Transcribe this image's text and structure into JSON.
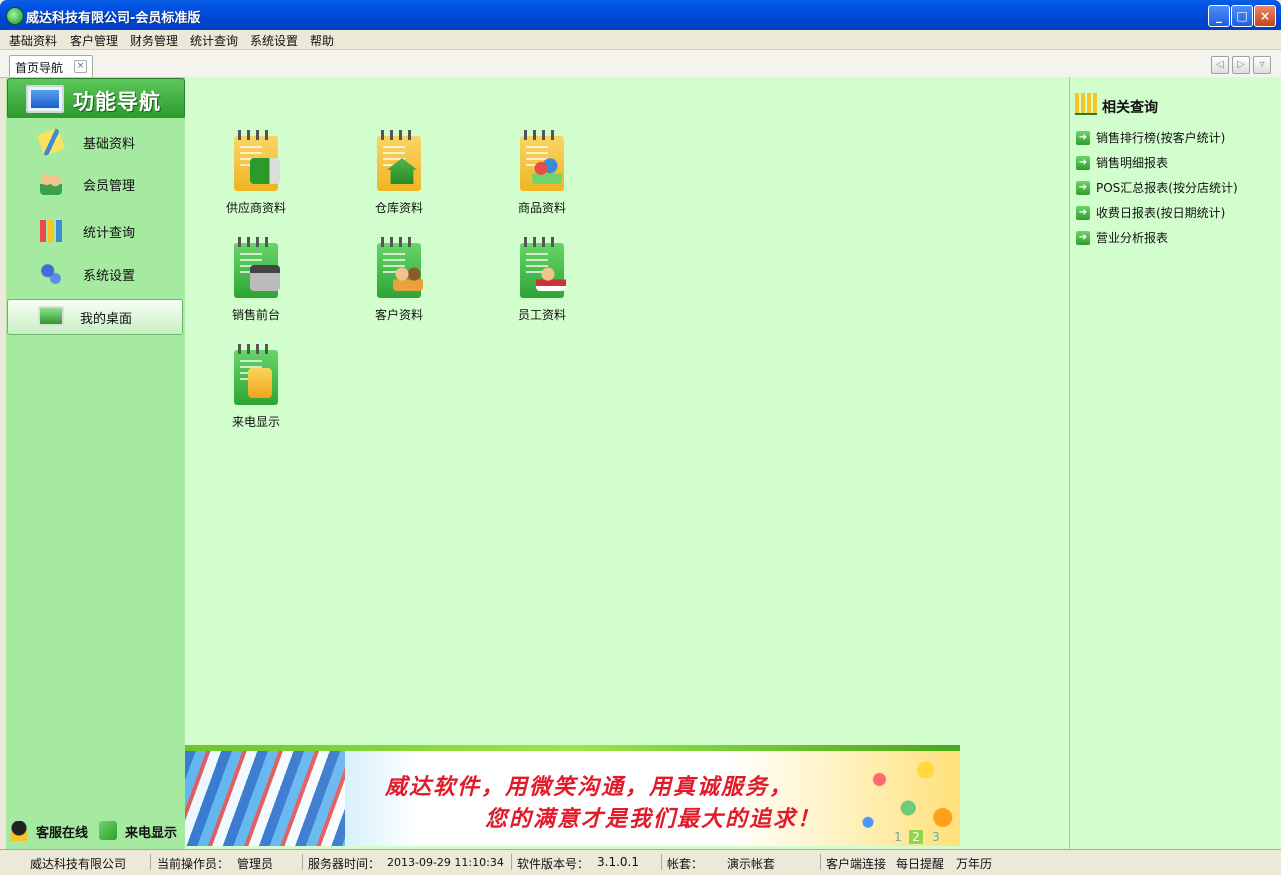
{
  "window": {
    "title": "威达科技有限公司-会员标准版"
  },
  "menu": [
    "基础资料",
    "客户管理",
    "财务管理",
    "统计查询",
    "系统设置",
    "帮助"
  ],
  "tabs": [
    {
      "label": "首页导航"
    }
  ],
  "sidebar": {
    "header": "功能导航",
    "items": [
      {
        "label": "基础资料",
        "icon": "pencil-icon"
      },
      {
        "label": "会员管理",
        "icon": "users-icon"
      },
      {
        "label": "统计查询",
        "icon": "chart-icon"
      },
      {
        "label": "系统设置",
        "icon": "gears-icon"
      },
      {
        "label": "我的桌面",
        "icon": "monitor-icon"
      }
    ],
    "bottom": {
      "service": "客服在线",
      "caller": "来电显示"
    }
  },
  "main": {
    "tiles": [
      {
        "label": "供应商资料",
        "icon": "truck-icon"
      },
      {
        "label": "仓库资料",
        "icon": "house-icon"
      },
      {
        "label": "商品资料",
        "icon": "product-icon"
      },
      {
        "label": "销售前台",
        "icon": "cash-register-icon"
      },
      {
        "label": "客户资料",
        "icon": "customers-icon"
      },
      {
        "label": "员工资料",
        "icon": "employee-icon"
      },
      {
        "label": "来电显示",
        "icon": "phone-icon"
      }
    ],
    "banner": {
      "line1": "威达软件，用微笑沟通，用真诚服务，",
      "line2": "您的满意才是我们最大的追求！",
      "pages": [
        "1",
        "2",
        "3"
      ]
    }
  },
  "right": {
    "title": "相关查询",
    "links": [
      "销售排行榜(按客户统计)",
      "销售明细报表",
      "POS汇总报表(按分店统计)",
      "收费日报表(按日期统计)",
      "营业分析报表"
    ]
  },
  "status": {
    "company": "威达科技有限公司",
    "operator_label": "当前操作员：",
    "operator": "管理员",
    "server_time_label": "服务器时间：",
    "server_time": "2013-09-29 11:10:34",
    "version_label": "软件版本号：",
    "version": "3.1.0.1",
    "account_label": "帐套：",
    "account": "演示帐套",
    "client": "客户端连接",
    "daily": "每日提醒",
    "calendar": "万年历"
  },
  "colors": {
    "accent": "#2d9a2e",
    "panel": "#d2fdcc",
    "sidebar": "#a6e9a1",
    "banner_text": "#e21b2a"
  }
}
